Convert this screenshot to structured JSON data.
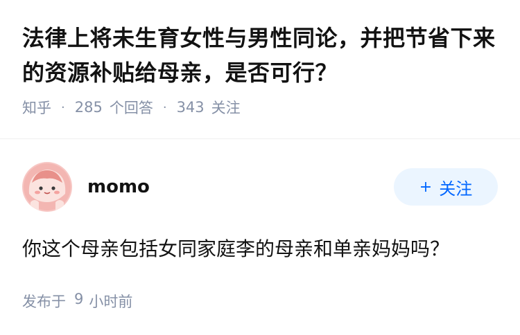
{
  "question": {
    "title": "法律上将未生育女性与男性同论，并把节省下来的资源补贴给母亲，是否可行？",
    "source": "知乎",
    "separator": "·",
    "answer_count": "285",
    "answer_label": "个回答",
    "follow_count": "343",
    "follow_label": "关注"
  },
  "answer": {
    "author_name": "momo",
    "follow_button_label": "关注",
    "follow_button_icon": "plus-icon",
    "text": "你这个母亲包括女同家庭李的母亲和单亲妈妈吗？",
    "time_prefix": "发布于",
    "time_value": "9",
    "time_unit": "小时前"
  },
  "colors": {
    "title": "#121212",
    "meta": "#8590a6",
    "accent": "#0066ff",
    "follow_bg": "#ebf5ff",
    "avatar_bg": "#f7c7c4"
  }
}
